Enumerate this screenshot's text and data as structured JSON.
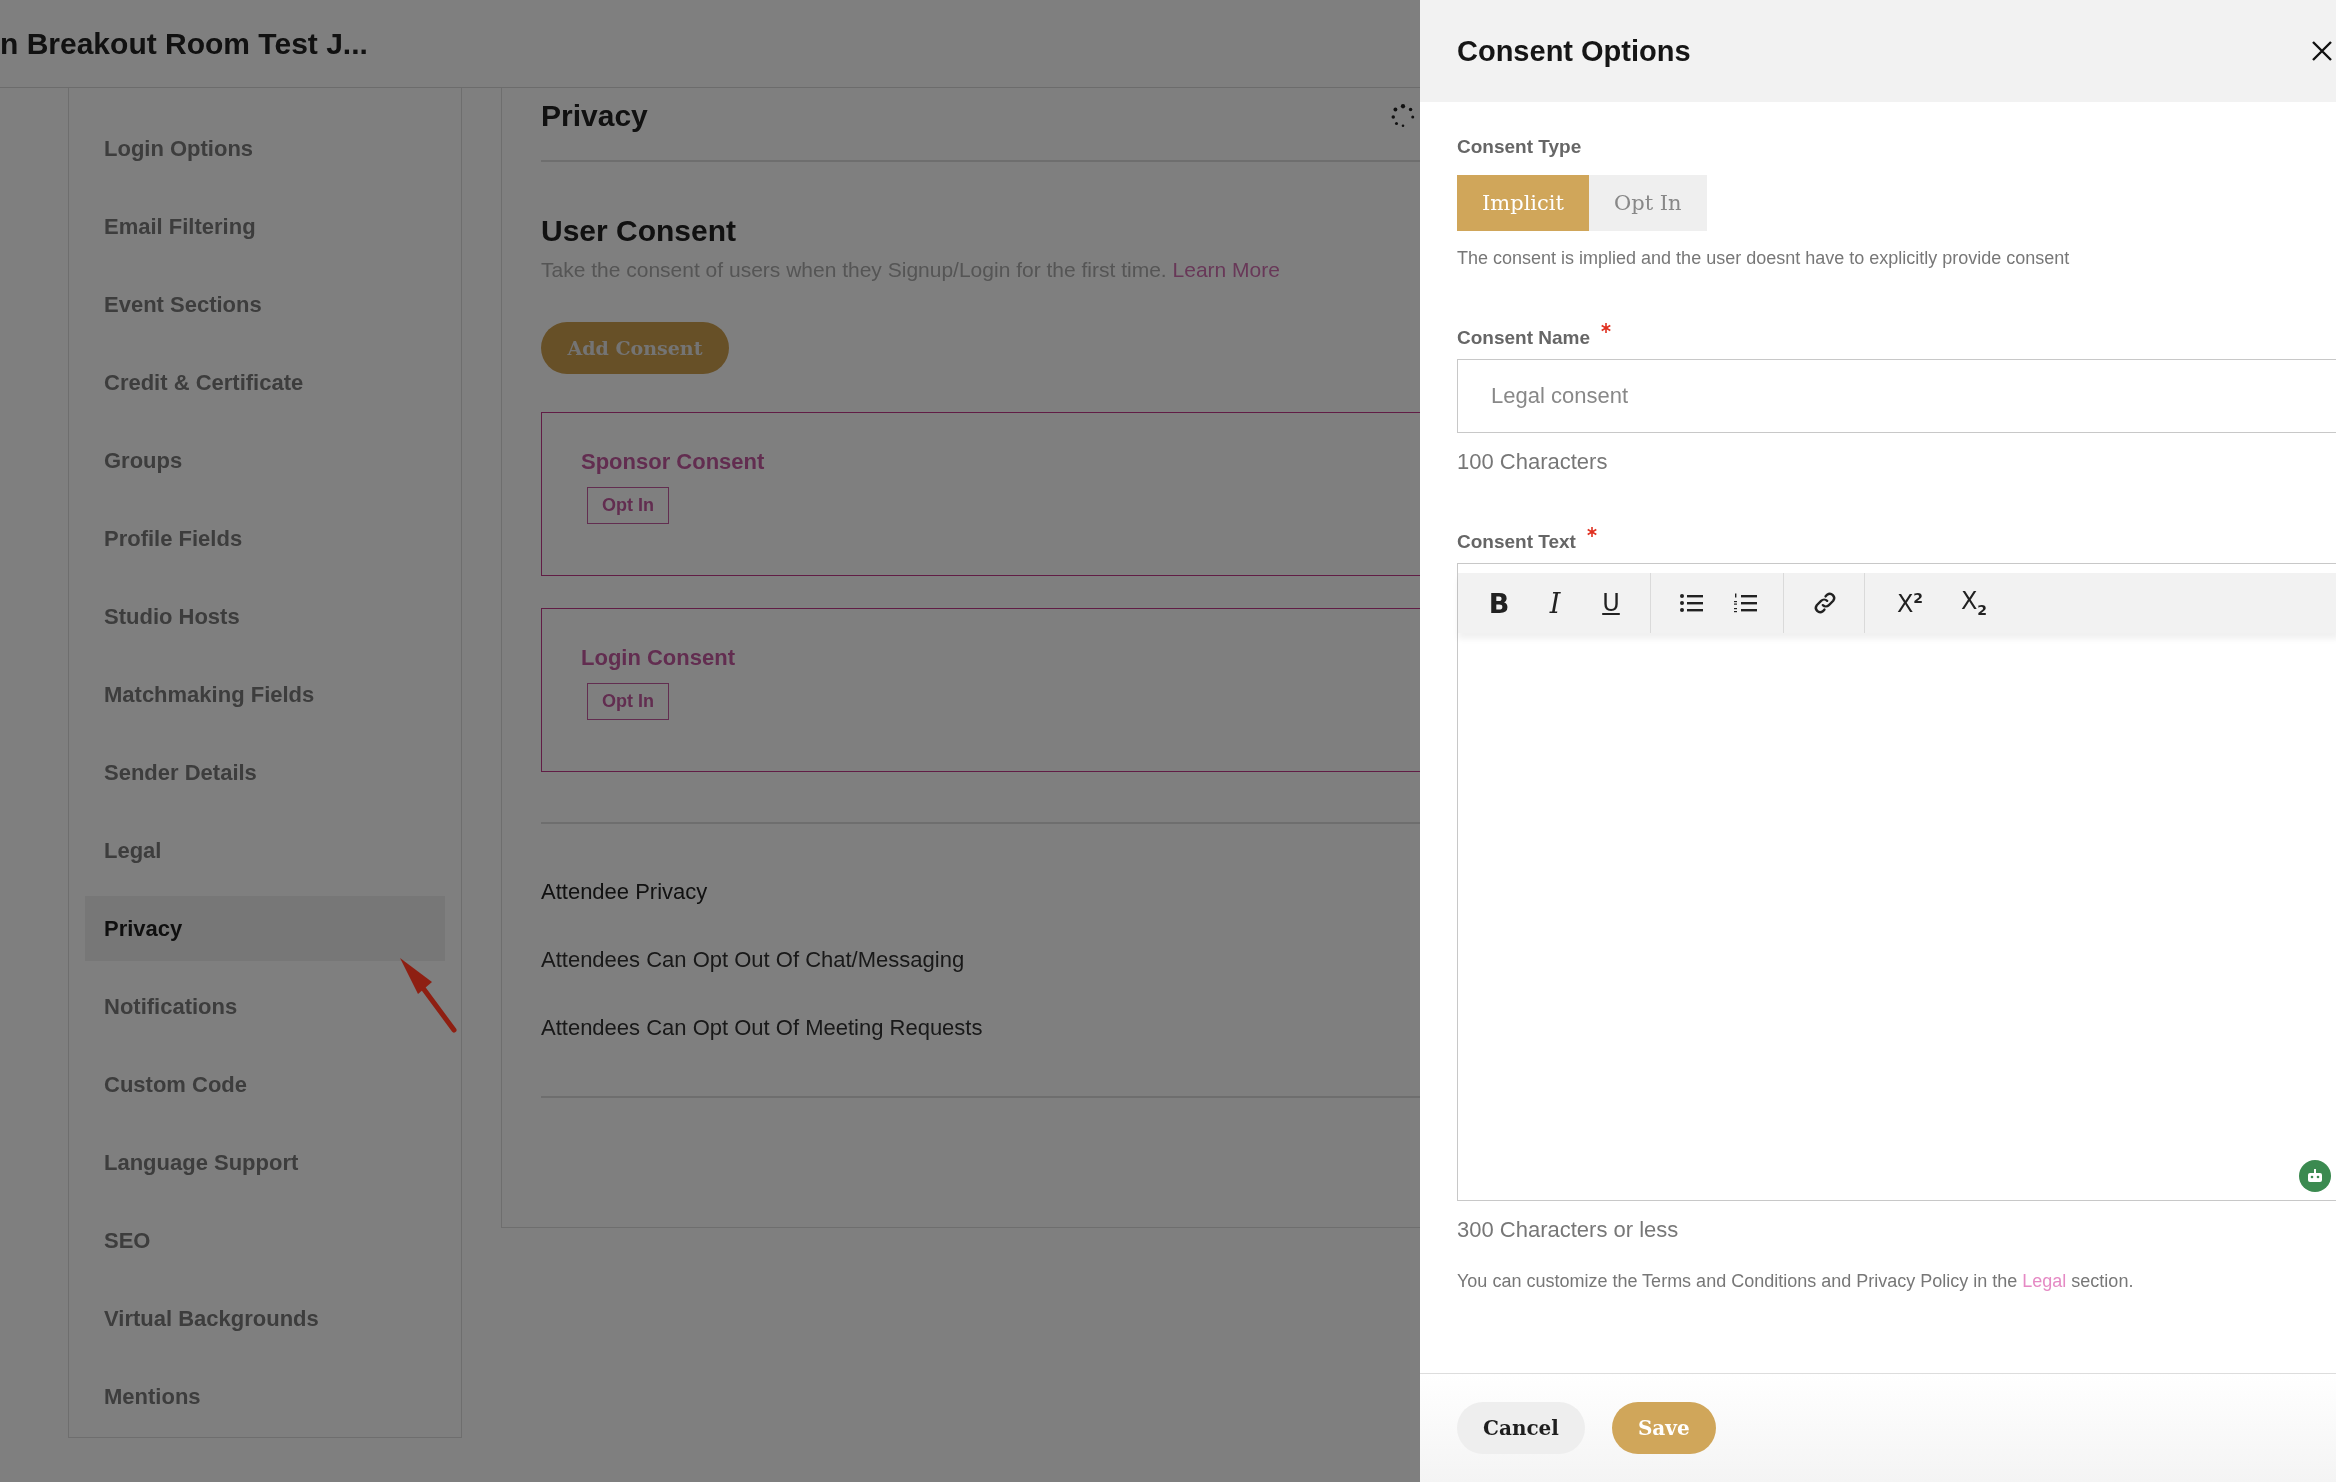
{
  "header": {
    "title": "n Breakout Room Test J..."
  },
  "sidebar": {
    "items": [
      {
        "label": "Login Options",
        "selected": false
      },
      {
        "label": "Email Filtering",
        "selected": false
      },
      {
        "label": "Event Sections",
        "selected": false
      },
      {
        "label": "Credit & Certificate",
        "selected": false
      },
      {
        "label": "Groups",
        "selected": false
      },
      {
        "label": "Profile Fields",
        "selected": false
      },
      {
        "label": "Studio Hosts",
        "selected": false
      },
      {
        "label": "Matchmaking Fields",
        "selected": false
      },
      {
        "label": "Sender Details",
        "selected": false
      },
      {
        "label": "Legal",
        "selected": false
      },
      {
        "label": "Privacy",
        "selected": true
      },
      {
        "label": "Notifications",
        "selected": false
      },
      {
        "label": "Custom Code",
        "selected": false
      },
      {
        "label": "Language Support",
        "selected": false
      },
      {
        "label": "SEO",
        "selected": false
      },
      {
        "label": "Virtual Backgrounds",
        "selected": false
      },
      {
        "label": "Mentions",
        "selected": false
      }
    ]
  },
  "main": {
    "heading": "Privacy",
    "user_consent": {
      "title": "User Consent",
      "description": "Take the consent of users when they Signup/Login for the first time.",
      "link": "Learn More",
      "add_button": "Add Consent"
    },
    "consents": [
      {
        "name": "Sponsor Consent",
        "badge": "Opt In"
      },
      {
        "name": "Login Consent",
        "badge": "Opt In"
      }
    ],
    "attendee_privacy": {
      "title": "Attendee Privacy",
      "options": [
        "Attendees Can Opt Out Of Chat/Messaging",
        "Attendees Can Opt Out Of Meeting Requests"
      ]
    }
  },
  "drawer": {
    "title": "Consent Options",
    "consent_type": {
      "label": "Consent Type",
      "options": [
        {
          "label": "Implicit",
          "selected": true
        },
        {
          "label": "Opt In",
          "selected": false
        }
      ],
      "description": "The consent is implied and the user doesnt have to explicitly provide consent"
    },
    "consent_name": {
      "label": "Consent Name",
      "required": true,
      "placeholder": "Legal consent",
      "hint": "100 Characters"
    },
    "consent_text": {
      "label": "Consent Text",
      "required": true,
      "hint": "300 Characters or less",
      "toolbar": [
        [
          {
            "kind": "bold",
            "label": "B"
          },
          {
            "kind": "italic",
            "label": "I"
          },
          {
            "kind": "underline",
            "label": "U"
          }
        ],
        [
          {
            "kind": "bullets"
          },
          {
            "kind": "numbered"
          }
        ],
        [
          {
            "kind": "link"
          }
        ],
        [
          {
            "kind": "superscript",
            "label": "X$^{2}$"
          },
          {
            "kind": "subscript",
            "label": "X$_{2}$"
          }
        ]
      ]
    },
    "note": {
      "before": "You can customize the Terms and Conditions and Privacy Policy in the",
      "link": "Legal",
      "after": "section."
    },
    "buttons": [
      {
        "kind": "secondary",
        "label": "Cancel"
      },
      {
        "kind": "primary",
        "label": "Save"
      }
    ]
  }
}
